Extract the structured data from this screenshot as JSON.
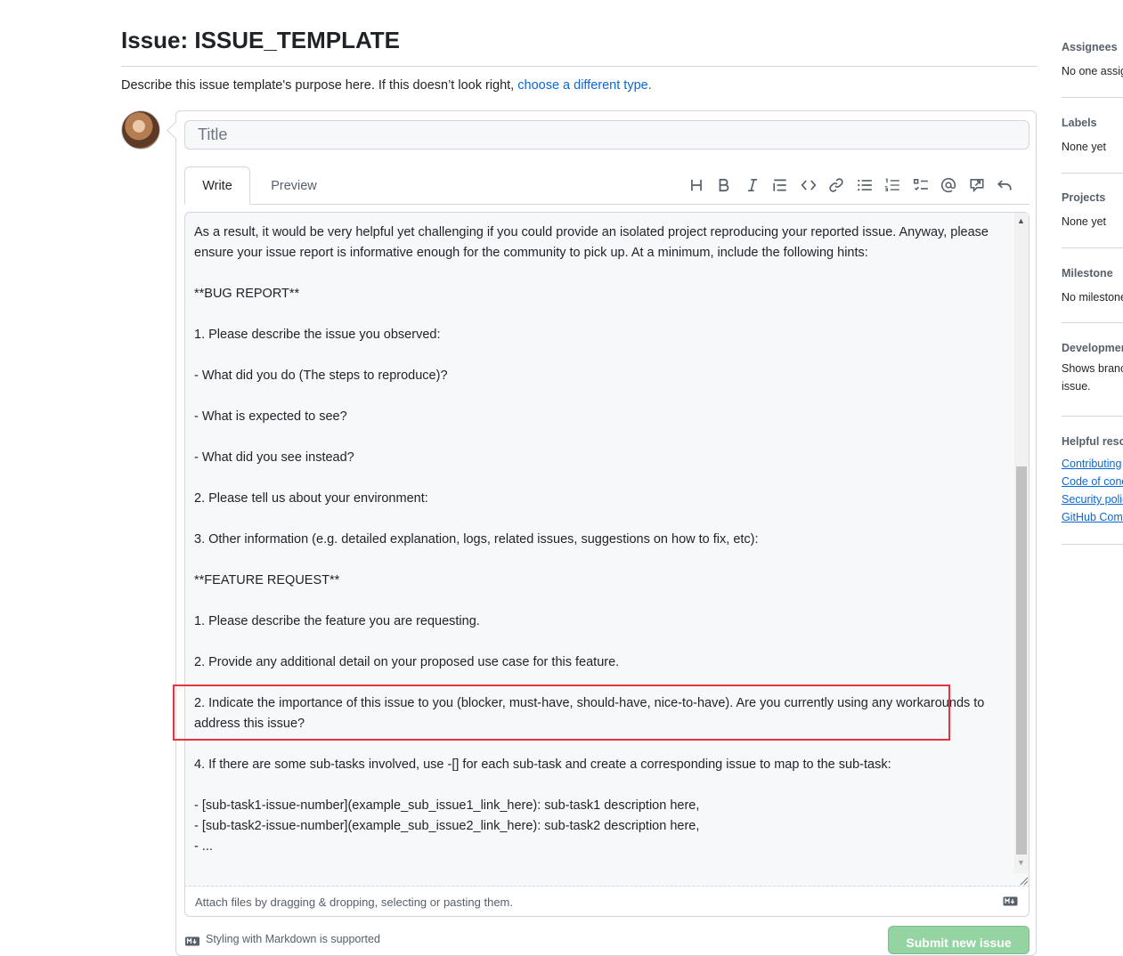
{
  "page": {
    "title": "Issue: ISSUE_TEMPLATE",
    "description": "Describe this issue template's purpose here. If this doesn’t look right, ",
    "description_link": "choose a different type."
  },
  "composer": {
    "title_placeholder": "Title",
    "tabs": [
      {
        "label": "Write",
        "selected": true
      },
      {
        "label": "Preview",
        "selected": false
      }
    ],
    "toolbar_icons": [
      "heading-icon",
      "bold-icon",
      "italic-icon",
      "quote-icon",
      "code-icon",
      "link-icon",
      "bulleted-list-icon",
      "numbered-list-icon",
      "task-list-icon",
      "mention-icon",
      "reference-icon",
      "undo-icon"
    ],
    "body_lines": [
      "As a result, it would be very helpful yet challenging if you could provide an isolated project reproducing your reported issue. Anyway, please ensure your issue report is informative enough for the community to pick up. At a minimum, include the following hints:",
      "",
      "**BUG REPORT**",
      "",
      "1. Please describe the issue you observed:",
      "",
      "- What did you do (The steps to reproduce)?",
      "",
      "- What is expected to see?",
      "",
      "- What did you see instead?",
      "",
      "2. Please tell us about your environment:",
      "",
      "3. Other information (e.g. detailed explanation, logs, related issues, suggestions on how to fix, etc):",
      "",
      "**FEATURE REQUEST**",
      "",
      "1. Please describe the feature you are requesting.",
      "",
      "2. Provide any additional detail on your proposed use case for this feature.",
      "",
      "2. Indicate the importance of this issue to you (blocker, must-have, should-have, nice-to-have). Are you currently using any workarounds to address this issue?",
      "",
      "4. If there are some sub-tasks involved, use -[] for each sub-task and create a corresponding issue to map to the sub-task:",
      "",
      "- [sub-task1-issue-number](example_sub_issue1_link_here): sub-task1 description here,",
      "- [sub-task2-issue-number](example_sub_issue2_link_here): sub-task2 description here,",
      "- ..."
    ],
    "attach_text": "Attach files by dragging & dropping, selecting or pasting them.",
    "markdown_note": "Styling with Markdown is supported",
    "submit_label": "Submit new issue"
  },
  "sidebar": {
    "assignees_heading": "Assignees",
    "assignees_value": "No one assigned",
    "labels_heading": "Labels",
    "labels_value": "None yet",
    "projects_heading": "Projects",
    "projects_value": "None yet",
    "milestone_heading": "Milestone",
    "milestone_value": "No milestone",
    "development_heading": "Development",
    "development_value_1": "Shows branches and pull requests linked to this",
    "development_value_2": "issue.",
    "helpful_heading": "Helpful resources",
    "helpful_links": [
      "Contributing",
      "Code of conduct",
      "Security policy",
      "GitHub Community Guidelines"
    ]
  },
  "colors": {
    "link": "#0969da",
    "highlight_box": "#e5343d",
    "submit_disabled": "#94d3a2"
  }
}
